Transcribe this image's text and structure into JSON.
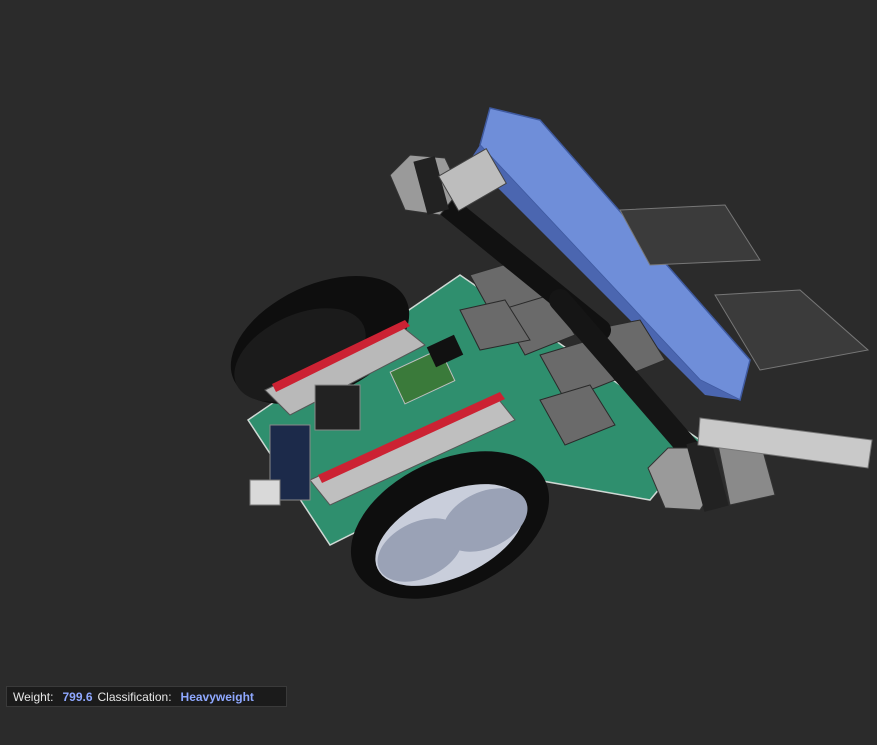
{
  "status": {
    "weight_label": "Weight:",
    "weight_value": "799.6",
    "classification_label": "Classification:",
    "classification_value": "Heavyweight"
  },
  "colors": {
    "background": "#2b2b2b",
    "value_text": "#8fa8ff",
    "plow_blue": "#6f8ed9",
    "chassis_green": "#2f8f6e"
  },
  "icons": {
    "model": "robot-3d-model"
  }
}
